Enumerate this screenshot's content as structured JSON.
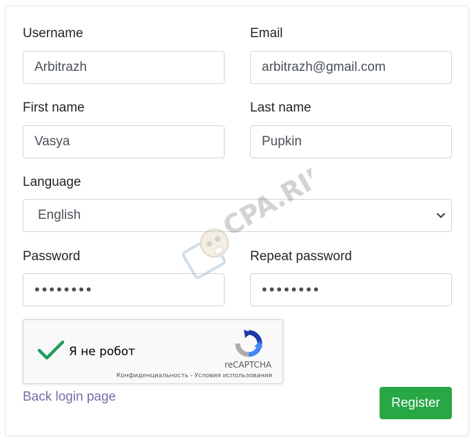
{
  "form": {
    "username": {
      "label": "Username",
      "value": "Arbitrazh"
    },
    "email": {
      "label": "Email",
      "value": "arbitrazh@gmail.com"
    },
    "first_name": {
      "label": "First name",
      "value": "Vasya"
    },
    "last_name": {
      "label": "Last name",
      "value": "Pupkin"
    },
    "language": {
      "label": "Language",
      "selected": "English"
    },
    "password": {
      "label": "Password",
      "value": "••••••••"
    },
    "repeat_password": {
      "label": "Repeat password",
      "value": "••••••••"
    }
  },
  "recaptcha": {
    "checkbox_label": "Я не робот",
    "brand": "reCAPTCHA",
    "links": "Конфиденциальность - Условия использования",
    "checked": true,
    "check_color": "#1e9e5a"
  },
  "actions": {
    "back_link": "Back login page",
    "register": "Register"
  },
  "watermark": {
    "text": "CPA.RIP"
  }
}
